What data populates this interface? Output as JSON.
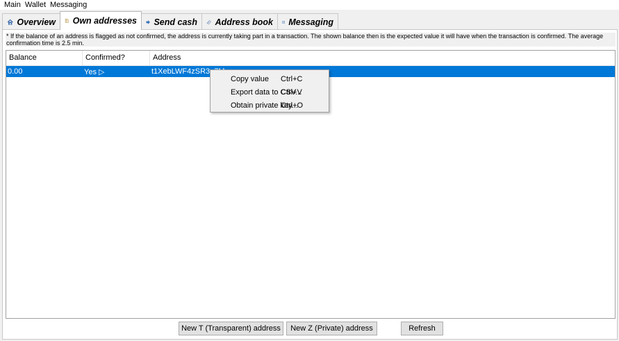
{
  "menubar": {
    "items": [
      "Main",
      "Wallet",
      "Messaging"
    ]
  },
  "tabs": [
    {
      "label": "Overview",
      "icon": "house-icon",
      "active": false
    },
    {
      "label": "Own addresses",
      "icon": "document-icon",
      "active": true
    },
    {
      "label": "Send cash",
      "icon": "arrow-right-icon",
      "active": false
    },
    {
      "label": "Address book",
      "icon": "book-icon",
      "active": false
    },
    {
      "label": "Messaging",
      "icon": "message-list-icon",
      "active": false
    }
  ],
  "notice": "* If the balance of an address is flagged as not confirmed, the address is currently taking part in a transaction. The shown balance then is the expected value it will have when the transaction is confirmed. The average confirmation time is 2.5 min.",
  "table": {
    "columns": [
      "Balance",
      "Confirmed?",
      "Address"
    ],
    "rows": [
      {
        "balance": "0.00",
        "confirmed": "Yes  ▷",
        "address": "t1XebLWF4zSR3e7M"
      }
    ]
  },
  "context_menu": {
    "items": [
      {
        "label": "Copy value",
        "shortcut": "Ctrl+C"
      },
      {
        "label": "Export data to CSV...",
        "shortcut": "Ctrl+V"
      },
      {
        "label": "Obtain private key...",
        "shortcut": "Ctrl+O"
      }
    ]
  },
  "buttons": {
    "new_t": "New T (Transparent) address",
    "new_z": "New Z (Private) address",
    "refresh": "Refresh"
  },
  "colors": {
    "selection": "#0078d7",
    "window_bg": "#f0f0f0"
  }
}
